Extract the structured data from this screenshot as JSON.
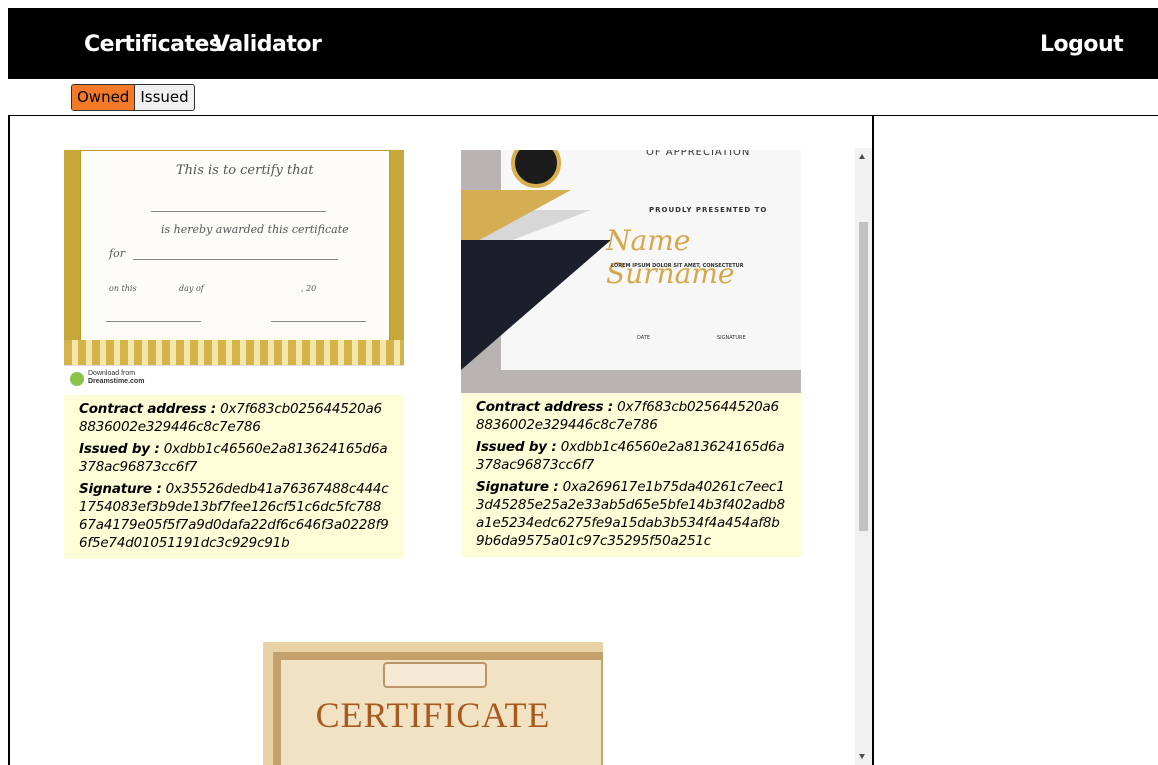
{
  "nav": {
    "certificates": "Certificates",
    "validator": "Validator",
    "logout": "Logout"
  },
  "tabs": {
    "owned": "Owned",
    "issued": "Issued",
    "active": "Owned"
  },
  "labels": {
    "contract": "Contract address :",
    "issued_by": "Issued by :",
    "signature": "Signature :"
  },
  "certificates": [
    {
      "contract_address": "0x7f683cb025644520a68836002e329446c8c7e786",
      "issued_by": "0xdbb1c46560e2a813624165d6a378ac96873cc6f7",
      "signature": "0x35526dedb41a76367488c444c1754083ef3b9de13bf7fee126cf51c6dc5fc78867a4179e05f5f7a9d0dafa22df6c646f3a0228f96f5e74d01051191dc3c929c91b",
      "image": {
        "line1": "This is to certify that",
        "line2": "is hereby awarded this certificate",
        "line3": "for",
        "line4": "on this",
        "line5": "day of",
        "line6": ", 20",
        "download_text": "Download from",
        "download_site": "Dreamstime.com"
      }
    },
    {
      "contract_address": "0x7f683cb025644520a68836002e329446c8c7e786",
      "issued_by": "0xdbb1c46560e2a813624165d6a378ac96873cc6f7",
      "signature": "0xa269617e1b75da40261c7eec13d45285e25a2e33ab5d65e5bfe14b3f402adb8a1e5234edc6275fe9a15dab3b534f4a454af8b9b6da9575a01c97c35295f50a251c",
      "image": {
        "heading": "OF APPRECIATION",
        "presented": "PROUDLY PRESENTED TO",
        "name": "Name Surname",
        "lorem": "LOREM IPSUM DOLOR SIT AMET, CONSECTETUR",
        "date": "DATE",
        "signature": "SIGNATURE",
        "medal": "AWARD"
      }
    },
    {
      "image": {
        "title": "CERTIFICATE"
      }
    }
  ],
  "colors": {
    "header_bg": "#000000",
    "active_tab": "#f47a2a",
    "card_info_bg": "#fdfed7"
  }
}
